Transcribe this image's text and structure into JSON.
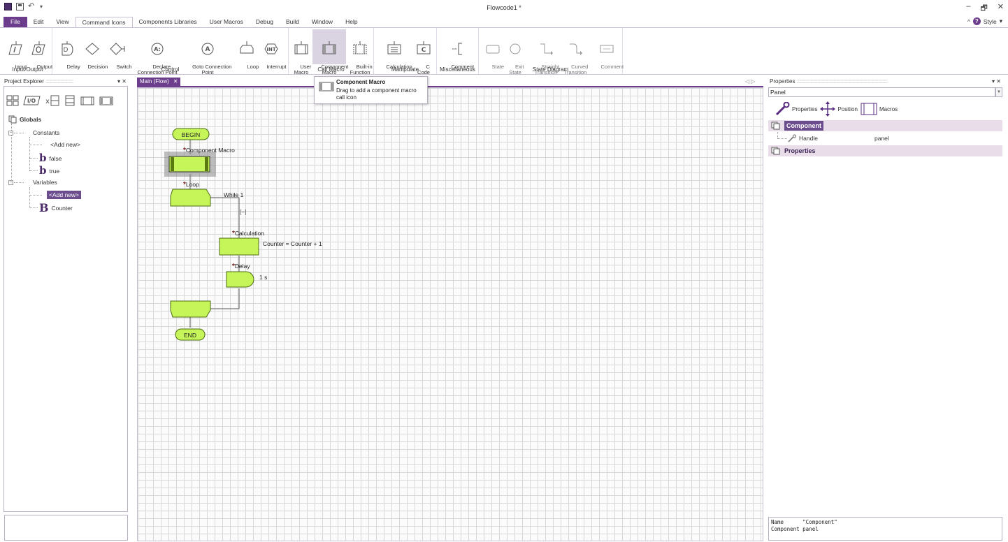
{
  "window": {
    "title": "Flowcode1 *",
    "controls": [
      "–",
      "🗗",
      "✕"
    ],
    "style_label": "Style"
  },
  "menu": {
    "file": "File",
    "tabs": [
      "Edit",
      "View",
      "Command Icons",
      "Components Libraries",
      "User Macros",
      "Debug",
      "Build",
      "Window",
      "Help"
    ]
  },
  "ribbon": {
    "groups": {
      "io": "Input/Output",
      "control": "Control",
      "call_macro": "Call Macro",
      "manipulate": "Manipulate",
      "misc": "Miscellaneous",
      "state": "State Diagram"
    },
    "buttons": {
      "input": "Input",
      "output": "Output",
      "delay": "Delay",
      "decision": "Decision",
      "switch": "Switch",
      "declare": "Declare\nConnection Point",
      "goto": "Goto Connection\nPoint",
      "loop": "Loop",
      "interrupt": "Interrupt",
      "user_macro": "User\nMacro",
      "component_macro": "Component\nMacro",
      "builtin": "Built-in\nFunction",
      "calculation": "Calculation",
      "ccode": "C\nCode",
      "comment": "Comment",
      "state": "State",
      "exit_state": "Exit\nState",
      "straight": "Straight\nTransition",
      "curved": "Curved\nTransition",
      "state_comment": "Comment"
    },
    "icon_text": {
      "delay": "D",
      "declare": "A:",
      "goto": "A",
      "interrupt": "INT",
      "ccode": "C"
    }
  },
  "tooltip": {
    "title": "Component Macro",
    "desc": "Drag to add a component macro call icon"
  },
  "project_explorer": {
    "title": "Project Explorer",
    "pin": "▾",
    "close": "✕",
    "io_icon_text": "I/O",
    "globals": "Globals",
    "constants": "Constants",
    "add_new": "<Add new>",
    "const_items": [
      "false",
      "true"
    ],
    "variables": "Variables",
    "var_items": [
      "Counter"
    ],
    "type_bool": "b",
    "type_byte": "B"
  },
  "editor": {
    "tab": "Main (Flow)",
    "tab_close": "✕",
    "nav": "◁ ▷",
    "begin": "BEGIN",
    "end": "END",
    "component_macro_label": "Component Macro",
    "loop_label": "Loop",
    "loop_condition": "While 1",
    "collapse": "[–]",
    "calculation_label": "Calculation",
    "calculation_expr": "Counter = Counter + 1",
    "delay_label": "Delay",
    "delay_value": "1 s",
    "star": "*"
  },
  "properties": {
    "title": "Properties",
    "pin": "▾",
    "close": "✕",
    "selected": "Panel",
    "tabs": [
      "Properties",
      "Position",
      "Macros"
    ],
    "categories": {
      "component": "Component",
      "properties": "Properties"
    },
    "rows": [
      {
        "name": "Handle",
        "value": "panel"
      }
    ],
    "desc_line1": "Name      \"Component\"",
    "desc_line2": "Component panel"
  },
  "colors": {
    "accent": "#6b3d8c",
    "flow_fill": "#c6f55a",
    "flow_stroke": "#4a6b10"
  }
}
